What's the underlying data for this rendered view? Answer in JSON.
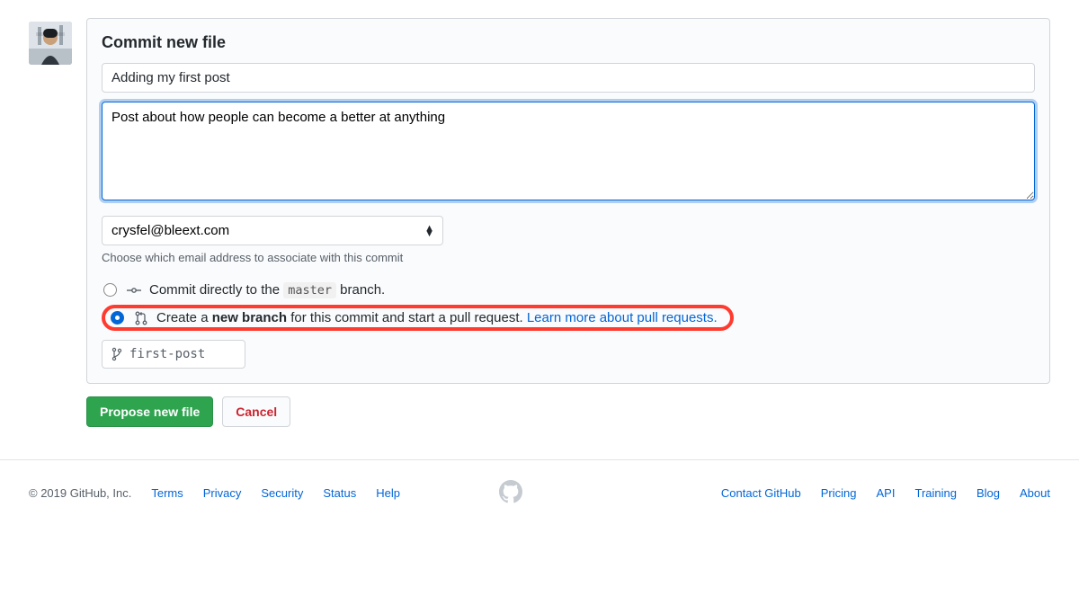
{
  "heading": "Commit new file",
  "summary": {
    "value": "Adding my first post"
  },
  "description": {
    "value": "Post about how people can become a better at anything"
  },
  "email": {
    "selected": "crysfel@bleext.com",
    "hint": "Choose which email address to associate with this commit"
  },
  "radios": {
    "direct": {
      "prefix": "Commit directly to the ",
      "branch": "master",
      "suffix": " branch."
    },
    "newbranch": {
      "prefix": "Create a ",
      "bold": "new branch",
      "suffix": " for this commit and start a pull request. ",
      "link": "Learn more about pull requests."
    }
  },
  "branch_input": {
    "value": "first-post"
  },
  "buttons": {
    "propose": "Propose new file",
    "cancel": "Cancel"
  },
  "footer": {
    "copyright": "© 2019 GitHub, Inc.",
    "left": [
      "Terms",
      "Privacy",
      "Security",
      "Status",
      "Help"
    ],
    "right": [
      "Contact GitHub",
      "Pricing",
      "API",
      "Training",
      "Blog",
      "About"
    ]
  }
}
